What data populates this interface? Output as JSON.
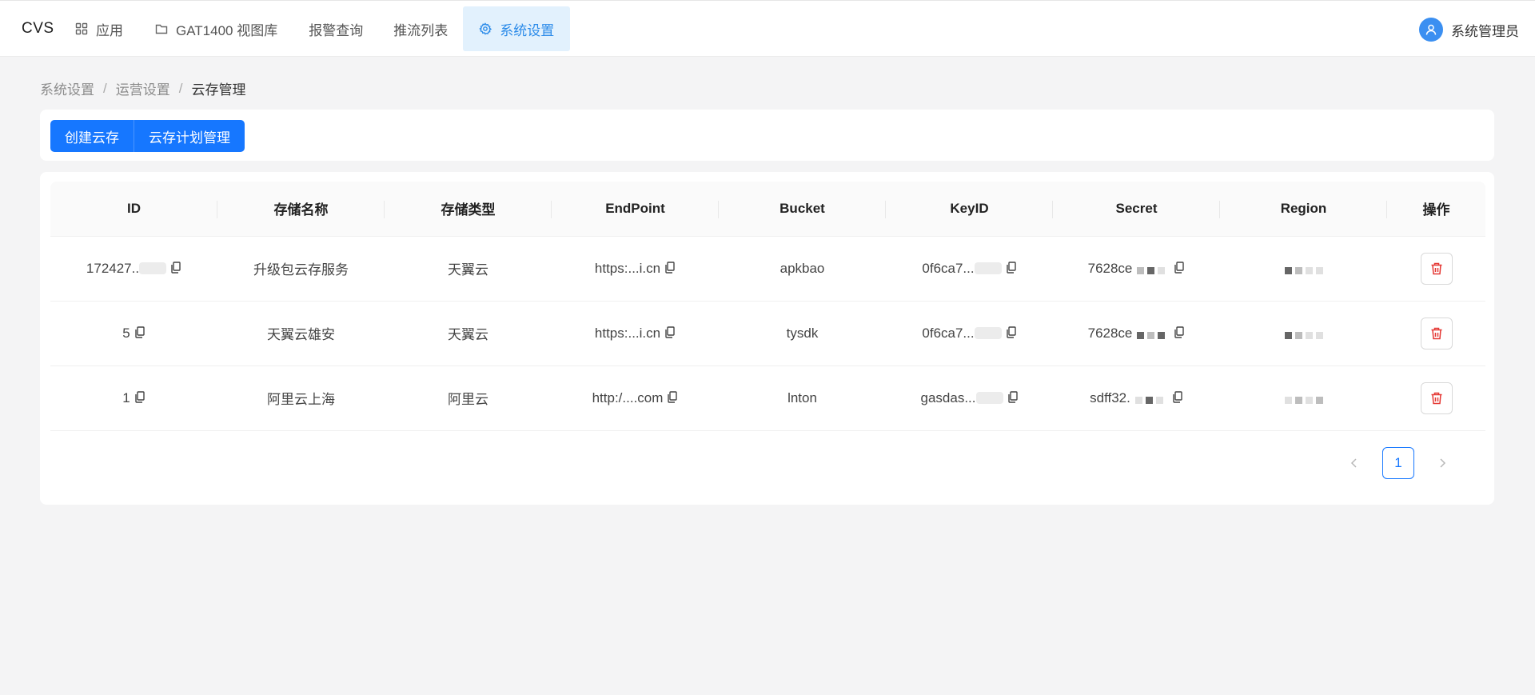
{
  "header": {
    "logo": "CVS",
    "nav": [
      {
        "label": "应用",
        "icon": "grid-icon"
      },
      {
        "label": "GAT1400 视图库",
        "icon": "folder-icon"
      },
      {
        "label": "报警查询"
      },
      {
        "label": "推流列表"
      },
      {
        "label": "系统设置",
        "icon": "gear-icon",
        "active": true
      }
    ],
    "user": "系统管理员"
  },
  "breadcrumb": [
    "系统设置",
    "运营设置",
    "云存管理"
  ],
  "toolbar": {
    "create_label": "创建云存",
    "plan_label": "云存计划管理"
  },
  "table": {
    "columns": [
      "ID",
      "存储名称",
      "存储类型",
      "EndPoint",
      "Bucket",
      "KeyID",
      "Secret",
      "Region",
      "操作"
    ],
    "rows": [
      {
        "id": "172427..",
        "name": "升级包云存服务",
        "type": "天翼云",
        "endpoint": "https:...i.cn",
        "bucket": "apkbao",
        "keyid": "0f6ca7...",
        "secret": "7628ce"
      },
      {
        "id": "5",
        "name": "天翼云雄安",
        "type": "天翼云",
        "endpoint": "https:...i.cn",
        "bucket": "tysdk",
        "keyid": "0f6ca7...",
        "secret": "7628ce"
      },
      {
        "id": "1",
        "name": "阿里云上海",
        "type": "阿里云",
        "endpoint": "http:/....com",
        "bucket": "lnton",
        "keyid": "gasdas...",
        "secret": "sdff32."
      }
    ]
  },
  "pagination": {
    "current": "1"
  },
  "colors": {
    "primary": "#1677ff",
    "nav_active_bg": "#e2f1fd",
    "nav_active_text": "#2b8be9",
    "danger": "#e53935"
  }
}
